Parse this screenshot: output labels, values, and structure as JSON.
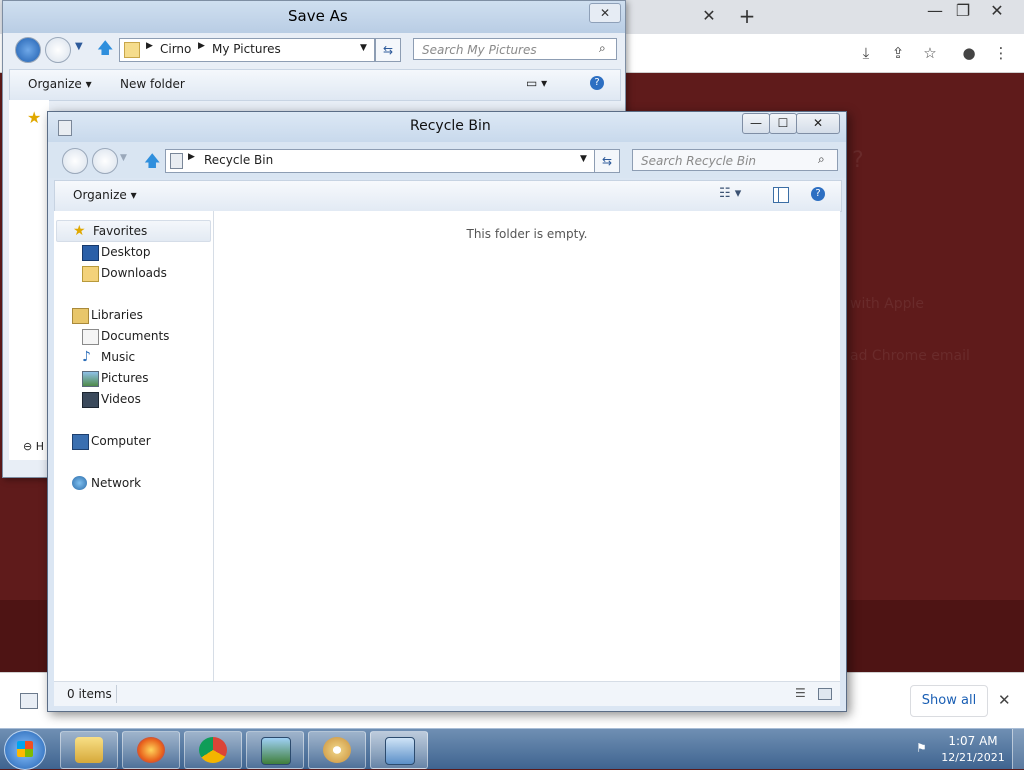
{
  "browser": {
    "ghost_lines": [
      "?",
      "with Apple",
      "ad Chrome email"
    ],
    "toolbar_icons": [
      "download-icon",
      "share-icon",
      "star-icon",
      "account-icon",
      "menu-icon"
    ],
    "download_bar": {
      "show_all_label": "Show all",
      "close_glyph": "✕"
    },
    "new_tab_glyph": "+",
    "tab_close_glyph": "✕",
    "window_controls": {
      "minimize": "—",
      "restore": "❐",
      "close": "✕"
    }
  },
  "save_as": {
    "title": "Save As",
    "address": {
      "crumb1": "Cirno",
      "crumb2": "My Pictures"
    },
    "search_placeholder": "Search My Pictures",
    "command_bar": {
      "organize": "Organize",
      "new_folder": "New folder"
    },
    "close_glyph": "✕",
    "nav_partial_label": "H"
  },
  "recycle_bin": {
    "title": "Recycle Bin",
    "window_controls": {
      "minimize": "—",
      "maximize": "☐",
      "close": "✕"
    },
    "address": {
      "location": "Recycle Bin"
    },
    "search_placeholder": "Search Recycle Bin",
    "command_bar": {
      "organize": "Organize"
    },
    "navigation": {
      "favorites": "Favorites",
      "desktop": "Desktop",
      "downloads": "Downloads",
      "libraries": "Libraries",
      "documents": "Documents",
      "music": "Music",
      "pictures": "Pictures",
      "videos": "Videos",
      "computer": "Computer",
      "network": "Network"
    },
    "empty_message": "This folder is empty.",
    "status": {
      "items": "0 items"
    }
  },
  "taskbar": {
    "apps": [
      "explorer-icon",
      "firefox-icon",
      "chrome-icon",
      "photo-viewer-icon",
      "paint-icon",
      "control-panel-icon"
    ],
    "clock": {
      "time": "1:07 AM",
      "date": "12/21/2021"
    }
  },
  "colors": {
    "browser_background": "#5f1b1b",
    "taskbar": "#3f6490",
    "window_frame": "#dbe6f3"
  }
}
